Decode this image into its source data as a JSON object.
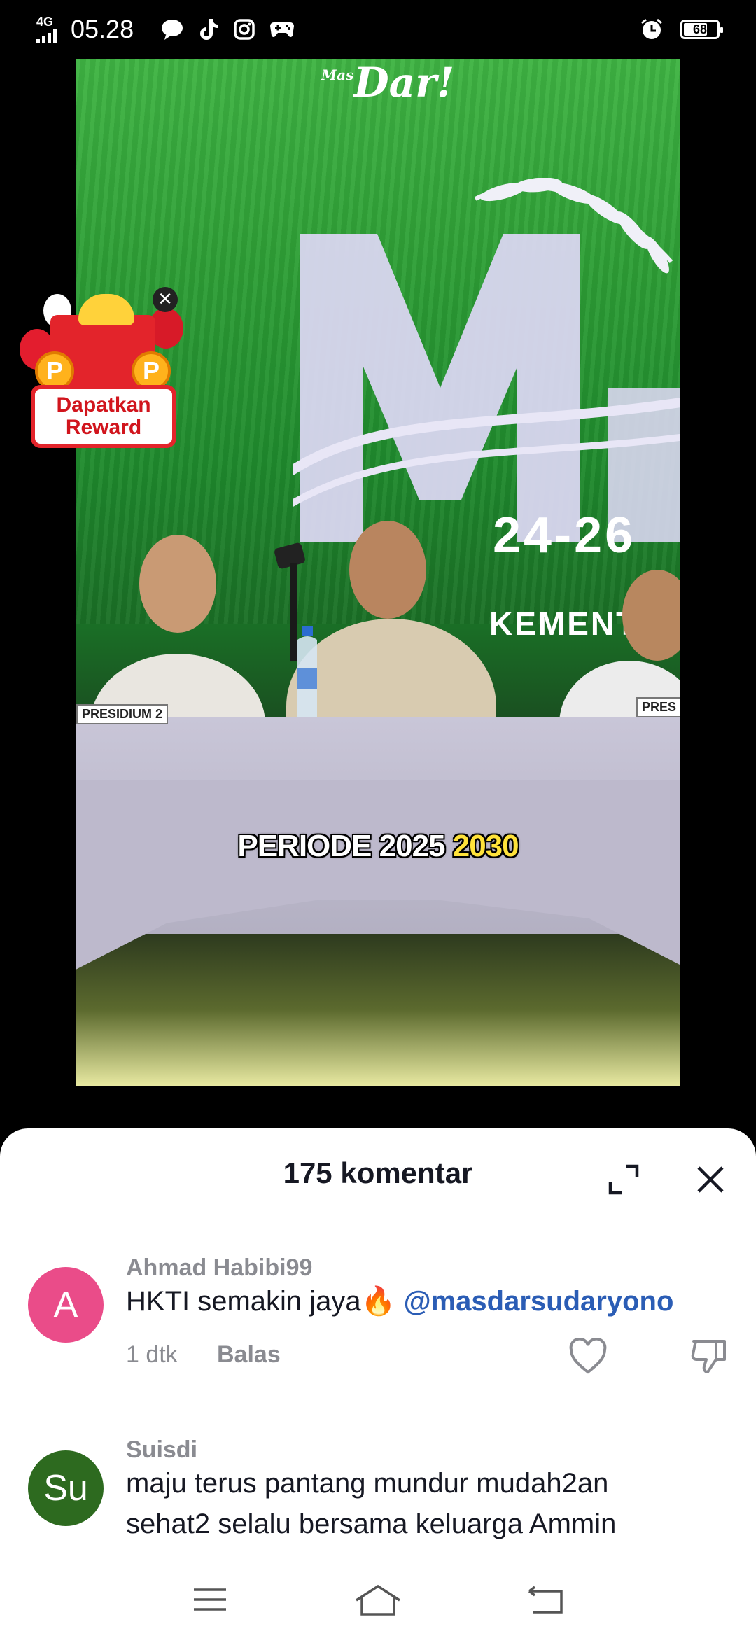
{
  "status_bar": {
    "network": "4G",
    "time": "05.28",
    "battery": "68",
    "icons": [
      "chat-icon",
      "tiktok-icon",
      "instagram-icon",
      "gamepad-icon",
      "alarm-icon"
    ]
  },
  "video": {
    "brand": "Dar!",
    "brand_prefix": "Mas",
    "date_text": "24-26",
    "sub_text": "KEMENT",
    "nameplate_left": "PRESIDIUM 2",
    "nameplate_right": "PRES",
    "caption_white": "PERIODE 2025 ",
    "caption_yellow": "2030"
  },
  "reward": {
    "line1": "Dapatkan",
    "line2": "Reward",
    "close": "✕"
  },
  "comments_sheet": {
    "title": "175 komentar",
    "comments": [
      {
        "avatar_letter": "A",
        "avatar_color": "#ea4c89",
        "username": "Ahmad Habibi99",
        "text": "HKTI semakin jaya🔥 ",
        "mention": "@masdarsudaryono",
        "time": "1 dtk",
        "reply_label": "Balas"
      },
      {
        "avatar_letter": "Su",
        "avatar_color": "#2d6a1f",
        "username": "Suisdi",
        "text_line1": "maju terus pantang mundur mudah2an",
        "text_line2": "sehat2 selalu bersama keluarga Ammin"
      }
    ]
  },
  "navbar": {
    "icons": [
      "menu-icon",
      "home-icon",
      "back-icon"
    ]
  }
}
